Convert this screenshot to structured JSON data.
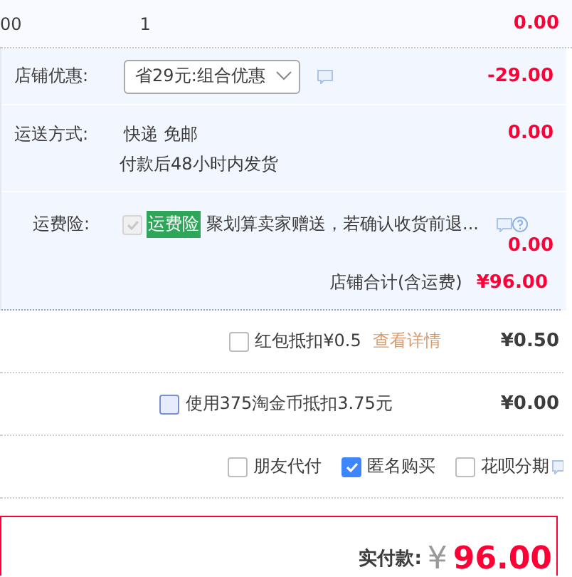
{
  "item_row": {
    "column_1": "00",
    "quantity": "1",
    "amount": "0.00"
  },
  "store_discount": {
    "label": "店铺优惠:",
    "select": "省29元:组合优惠",
    "amount": "-29.00"
  },
  "shipping": {
    "label": "运送方式:",
    "method": "快递 免邮",
    "note": "付款后48小时内发货",
    "amount": "0.00"
  },
  "insurance": {
    "label": "运费险:",
    "checked": true,
    "disabled": true,
    "tag": "运费险",
    "text": "聚划算卖家赠送，若确认收货前退...",
    "amount": "0.00"
  },
  "store_total": {
    "label": "店铺合计(含运费)",
    "amount": "¥96.00"
  },
  "red_packet": {
    "checked": false,
    "label": "红包抵扣¥0.5",
    "link": "查看详情",
    "amount": "¥0.50"
  },
  "coins": {
    "checked": false,
    "label": "使用375淘金币抵扣3.75元",
    "amount": "¥0.00"
  },
  "options": [
    {
      "label": "朋友代付",
      "checked": false
    },
    {
      "label": "匿名购买",
      "checked": true
    },
    {
      "label": "花呗分期",
      "checked": false
    }
  ],
  "payment": {
    "label": "实付款:",
    "currency": "¥",
    "amount": "96.00"
  }
}
